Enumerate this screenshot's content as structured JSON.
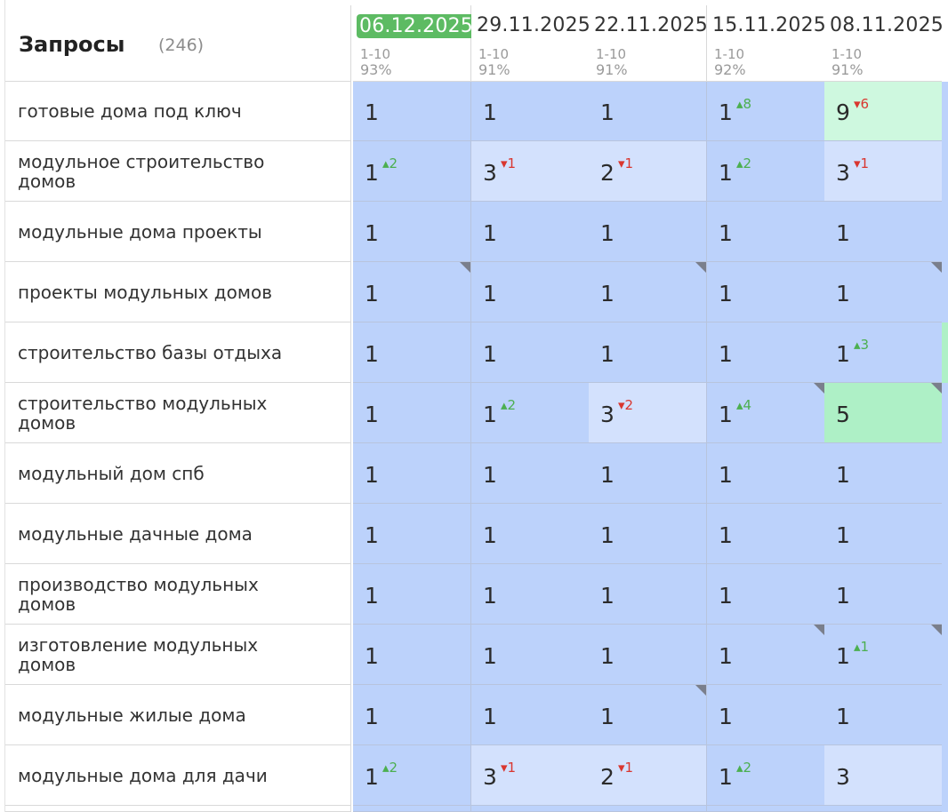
{
  "header": {
    "title": "Запросы",
    "count": "(246)"
  },
  "dates": [
    {
      "label": "06.12.2025",
      "range": "1-10",
      "pct": "93%",
      "active": true
    },
    {
      "label": "29.11.2025",
      "range": "1-10",
      "pct": "91%",
      "active": false
    },
    {
      "label": "22.11.2025",
      "range": "1-10",
      "pct": "91%",
      "active": false
    },
    {
      "label": "15.11.2025",
      "range": "1-10",
      "pct": "92%",
      "active": false
    },
    {
      "label": "08.11.2025",
      "range": "1-10",
      "pct": "91%",
      "active": false
    }
  ],
  "colors": {
    "top1": "#bcd2fb",
    "top3": "#d3e1fd",
    "top5": "#aef0c6",
    "top10": "#cef8df",
    "active_date": "#5dbb63",
    "up": "#4caf50",
    "down": "#d9362f"
  },
  "rows": [
    {
      "query": "готовые дома под ключ",
      "cells": [
        {
          "pos": "1"
        },
        {
          "pos": "1"
        },
        {
          "pos": "1"
        },
        {
          "pos": "1",
          "delta": "8",
          "dir": "up"
        },
        {
          "pos": "9",
          "delta": "6",
          "dir": "down",
          "zone": "top10"
        }
      ],
      "edge": "top1"
    },
    {
      "query": "модульное строительство домов",
      "cells": [
        {
          "pos": "1",
          "delta": "2",
          "dir": "up"
        },
        {
          "pos": "3",
          "delta": "1",
          "dir": "down",
          "zone": "top3"
        },
        {
          "pos": "2",
          "delta": "1",
          "dir": "down",
          "zone": "top3"
        },
        {
          "pos": "1",
          "delta": "2",
          "dir": "up"
        },
        {
          "pos": "3",
          "delta": "1",
          "dir": "down",
          "zone": "top3"
        }
      ],
      "edge": "top1"
    },
    {
      "query": "модульные дома проекты",
      "cells": [
        {
          "pos": "1"
        },
        {
          "pos": "1"
        },
        {
          "pos": "1"
        },
        {
          "pos": "1"
        },
        {
          "pos": "1"
        }
      ],
      "edge": "top1"
    },
    {
      "query": "проекты модульных домов",
      "cells": [
        {
          "pos": "1",
          "corner": true
        },
        {
          "pos": "1"
        },
        {
          "pos": "1",
          "corner": true
        },
        {
          "pos": "1"
        },
        {
          "pos": "1",
          "corner": true
        }
      ],
      "edge": "top1"
    },
    {
      "query": "строительство базы отдыха",
      "cells": [
        {
          "pos": "1"
        },
        {
          "pos": "1"
        },
        {
          "pos": "1"
        },
        {
          "pos": "1"
        },
        {
          "pos": "1",
          "delta": "3",
          "dir": "up"
        }
      ],
      "edge": "top5"
    },
    {
      "query": "строительство модульных домов",
      "cells": [
        {
          "pos": "1"
        },
        {
          "pos": "1",
          "delta": "2",
          "dir": "up"
        },
        {
          "pos": "3",
          "delta": "2",
          "dir": "down",
          "zone": "top3"
        },
        {
          "pos": "1",
          "delta": "4",
          "dir": "up",
          "corner": true
        },
        {
          "pos": "5",
          "zone": "top5",
          "corner": true
        }
      ],
      "edge": "top1"
    },
    {
      "query": "модульный дом спб",
      "cells": [
        {
          "pos": "1"
        },
        {
          "pos": "1"
        },
        {
          "pos": "1"
        },
        {
          "pos": "1"
        },
        {
          "pos": "1"
        }
      ],
      "edge": "top1"
    },
    {
      "query": "модульные дачные дома",
      "cells": [
        {
          "pos": "1"
        },
        {
          "pos": "1"
        },
        {
          "pos": "1"
        },
        {
          "pos": "1"
        },
        {
          "pos": "1"
        }
      ],
      "edge": "top1"
    },
    {
      "query": "производство модульных домов",
      "cells": [
        {
          "pos": "1"
        },
        {
          "pos": "1"
        },
        {
          "pos": "1"
        },
        {
          "pos": "1"
        },
        {
          "pos": "1"
        }
      ],
      "edge": "top1"
    },
    {
      "query": "изготовление модульных домов",
      "cells": [
        {
          "pos": "1"
        },
        {
          "pos": "1"
        },
        {
          "pos": "1"
        },
        {
          "pos": "1",
          "corner": true
        },
        {
          "pos": "1",
          "delta": "1",
          "dir": "up",
          "corner": true
        }
      ],
      "edge": "top1"
    },
    {
      "query": "модульные жилые дома",
      "cells": [
        {
          "pos": "1"
        },
        {
          "pos": "1"
        },
        {
          "pos": "1",
          "corner": true
        },
        {
          "pos": "1"
        },
        {
          "pos": "1"
        }
      ],
      "edge": "top1"
    },
    {
      "query": "модульные дома для дачи",
      "cells": [
        {
          "pos": "1",
          "delta": "2",
          "dir": "up"
        },
        {
          "pos": "3",
          "delta": "1",
          "dir": "down",
          "zone": "top3"
        },
        {
          "pos": "2",
          "delta": "1",
          "dir": "down",
          "zone": "top3"
        },
        {
          "pos": "1",
          "delta": "2",
          "dir": "up"
        },
        {
          "pos": "3",
          "zone": "top3"
        }
      ],
      "edge": "top1"
    },
    {
      "query": "",
      "cells": [
        {
          "pos": ""
        },
        {
          "pos": ""
        },
        {
          "pos": ""
        },
        {
          "pos": ""
        },
        {
          "pos": ""
        }
      ],
      "edge": "top1"
    }
  ]
}
